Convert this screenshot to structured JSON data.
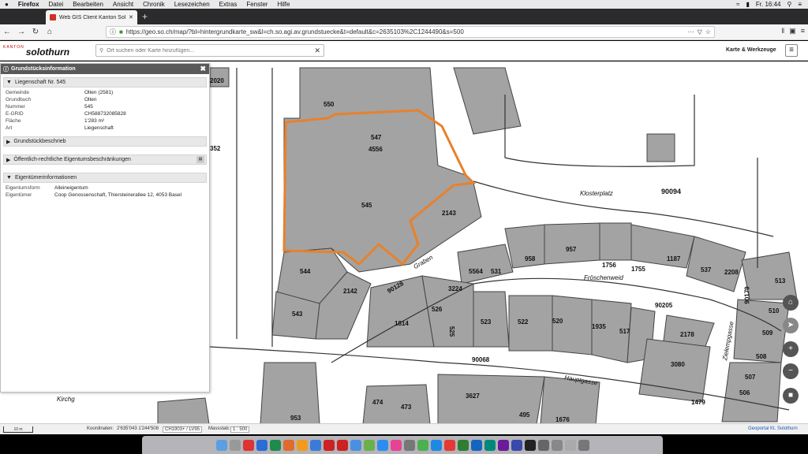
{
  "menubar": {
    "apple": "",
    "items": [
      "Firefox",
      "Datei",
      "Bearbeiten",
      "Ansicht",
      "Chronik",
      "Lesezeichen",
      "Extras",
      "Fenster",
      "Hilfe"
    ],
    "clock": "Fr. 16:44"
  },
  "browser": {
    "tab_title": "Web GIS Client Kanton Solothurn",
    "new_tab": "+",
    "url": "https://geo.so.ch/map/?bl=hintergrundkarte_sw&l=ch.so.agi.av.grundstuecke&t=default&c=2635103%2C1244490&s=500"
  },
  "app": {
    "logo_kanton": "KANTON",
    "logo_name": "solothurn",
    "search_placeholder": "Ort suchen oder Karte hinzufügen...",
    "tools_label": "Karte & Werkzeuge"
  },
  "panel": {
    "title": "Grundstücksinformation",
    "section_main": "Liegenschaft Nr. 545",
    "rows": [
      {
        "k": "Gemeinde",
        "v": "Olten (2581)"
      },
      {
        "k": "Grundbuch",
        "v": "Olten"
      },
      {
        "k": "Nummer",
        "v": "545"
      },
      {
        "k": "E-GRID",
        "v": "CH588732085828"
      },
      {
        "k": "Fläche",
        "v": "1'283 m²"
      },
      {
        "k": "Art",
        "v": "Liegenschaft"
      }
    ],
    "section_desc": "Grundstückbeschrieb",
    "section_oerek": "Öffentlich-rechtliche Eigentumsbeschränkungen",
    "section_owner": "Eigentümerinformationen",
    "owner_rows": [
      {
        "k": "Eigentumsform",
        "v": "Alleineigentum"
      },
      {
        "k": "Eigentümer",
        "v": "Coop Genossenschaft, Thiersteinerallee 12, 4053 Basel"
      }
    ]
  },
  "map": {
    "labels": [
      "550",
      "547",
      "4556",
      "545",
      "2143",
      "544",
      "2142",
      "543",
      "958",
      "957",
      "1756",
      "1755",
      "1187",
      "537",
      "2208",
      "513",
      "5564",
      "531",
      "3224",
      "526",
      "1814",
      "523",
      "522",
      "520",
      "1935",
      "517",
      "2178",
      "3080",
      "3627",
      "495",
      "474",
      "473",
      "90094",
      "90128",
      "90205",
      "90179",
      "90068",
      "508",
      "507",
      "506",
      "1479",
      "510",
      "509",
      "2020",
      "352",
      "953",
      "1676",
      "525"
    ],
    "streets": [
      "Klosterplatz",
      "Graben",
      "Fröschenweid",
      "Hauptgasse",
      "Zielempgasse",
      "Kirchg"
    ]
  },
  "footer": {
    "scale_bar": "10 m",
    "coords_label": "Koordinaten:",
    "coords": "2'635'043 1'244'508",
    "crs": "CH1903+ / LV95",
    "scale_label": "Massstab:",
    "scale": "1 : 500",
    "portal": "Geoportal Kt. Solothurn"
  },
  "colors": {
    "parcel_fill": "#a3a3a3",
    "highlight": "#e8812b",
    "panel_header": "#595959"
  }
}
